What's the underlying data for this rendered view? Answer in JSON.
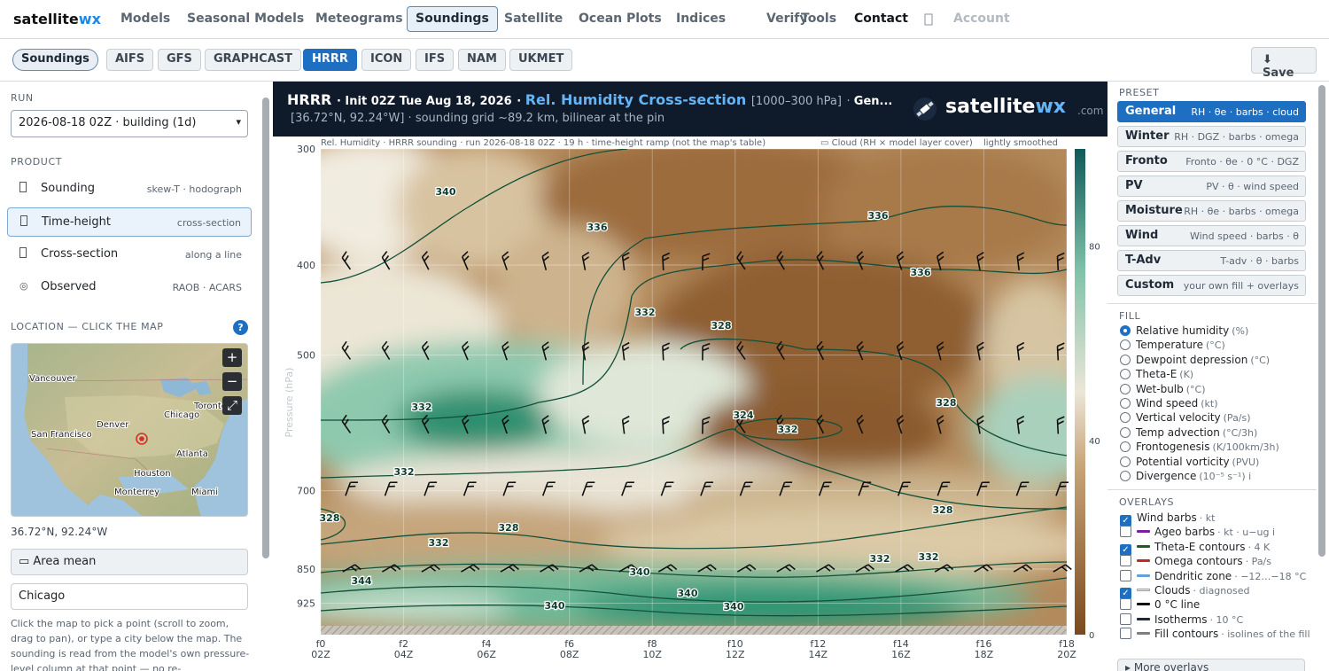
{
  "nav": {
    "brand_a": "satellite",
    "brand_b": "wx",
    "items": [
      "Models",
      "Seasonal Models",
      "Meteograms",
      "Soundings",
      "Satellite",
      "Ocean Plots",
      "Indices",
      "Verify",
      "Tools",
      "Contact"
    ],
    "active_item": "Soundings",
    "icon": "person-icon",
    "account": "Account"
  },
  "subnav": {
    "section": "Soundings",
    "models": [
      "AIFS",
      "GFS",
      "GRAPHCAST",
      "HRRR",
      "ICON",
      "IFS",
      "NAM",
      "UKMET"
    ],
    "selected_model": "HRRR",
    "save": "⬇ Save"
  },
  "left": {
    "run_heading": "RUN",
    "run_value": "2026-08-18 02Z · building (1d)",
    "product_heading": "PRODUCT",
    "products": [
      {
        "name": "Sounding",
        "desc": "skew-T · hodograph",
        "icon": "chart-icon"
      },
      {
        "name": "Time-height",
        "desc": "cross-section",
        "icon": "clock-icon"
      },
      {
        "name": "Cross-section",
        "desc": "along a line",
        "icon": "line-icon"
      },
      {
        "name": "Observed",
        "desc": "RAOB · ACARS",
        "icon": "◎"
      }
    ],
    "selected_product": "Time-height",
    "location_heading": "LOCATION — CLICK THE MAP",
    "help": "?",
    "map_labels": [
      "Vancouver",
      "Chicago",
      "Toronto",
      "Denver",
      "San Francisco",
      "Atlanta",
      "Houston",
      "Monterrey",
      "Miami"
    ],
    "zoom_in": "+",
    "zoom_out": "−",
    "fullscreen": "⤢",
    "coords": "36.72°N, 92.24°W",
    "area_mean": "▭ Area mean",
    "city": "Chicago",
    "help_text": "Click the map to pick a point (scroll to zoom, drag to pan), or type a city below the map. The sounding is read from the model's own pressure-level column at that point — no re-"
  },
  "chart_header": {
    "model": "HRRR",
    "init": "Init 02Z Tue Aug 18, 2026",
    "product": "Rel. Humidity Cross-section",
    "range": "[1000–300 hPa]",
    "preset_short": "Gen...",
    "sub": "[36.72°N, 92.24°W]  ·  sounding grid ~89.2 km, bilinear at the pin",
    "logo_a": "satellite",
    "logo_b": "wx",
    "logo_c": ".com"
  },
  "chart_data": {
    "type": "heatmap",
    "caption": "Rel. Humidity · HRRR sounding · run 2026-08-18 02Z · 19 h · time-height ramp (not the map's table)",
    "cloud_legend": "▭ Cloud (RH × model layer cover)",
    "smoothing": "lightly smoothed",
    "ylabel": "Pressure (hPa)",
    "y_ticks": [
      300,
      400,
      500,
      700,
      850,
      925
    ],
    "ylim": [
      1000,
      300
    ],
    "x_ticks_top": [
      "f0",
      "f2",
      "f4",
      "f6",
      "f8",
      "f10",
      "f12",
      "f14",
      "f16",
      "f18"
    ],
    "x_ticks_bottom": [
      "02Z",
      "04Z",
      "06Z",
      "08Z",
      "10Z",
      "12Z",
      "14Z",
      "16Z",
      "18Z",
      "20Z"
    ],
    "colorbar_ticks": [
      0,
      40,
      80
    ],
    "contour_labels": [
      "340",
      "336",
      "336",
      "332",
      "332",
      "328",
      "336",
      "324",
      "328",
      "332",
      "328",
      "328",
      "328",
      "332",
      "332",
      "340",
      "332",
      "344",
      "340",
      "340",
      "340",
      "332"
    ],
    "barb_levels_hpa": [
      400,
      500,
      600,
      700,
      850
    ],
    "colors": {
      "moist": "#1a8f6e",
      "dry": "#8a5a2b",
      "contour": "#12503a"
    }
  },
  "right": {
    "preset_heading": "PRESET",
    "presets": [
      {
        "name": "General",
        "desc": "RH · θe · barbs · cloud"
      },
      {
        "name": "Winter",
        "desc": "RH · DGZ · barbs · omega"
      },
      {
        "name": "Fronto",
        "desc": "Fronto · θe · 0 °C · DGZ"
      },
      {
        "name": "PV",
        "desc": "PV · θ · wind speed"
      },
      {
        "name": "Moisture",
        "desc": "RH · θe · barbs · omega"
      },
      {
        "name": "Wind",
        "desc": "Wind speed · barbs · θ"
      },
      {
        "name": "T-Adv",
        "desc": "T-adv · θ · barbs"
      },
      {
        "name": "Custom",
        "desc": "your own fill + overlays"
      }
    ],
    "selected_preset": "General",
    "fill_heading": "FILL",
    "fills": [
      {
        "name": "Relative humidity",
        "unit": "(%)"
      },
      {
        "name": "Temperature",
        "unit": "(°C)"
      },
      {
        "name": "Dewpoint depression",
        "unit": "(°C)"
      },
      {
        "name": "Theta-E",
        "unit": "(K)"
      },
      {
        "name": "Wet-bulb",
        "unit": "(°C)"
      },
      {
        "name": "Wind speed",
        "unit": "(kt)"
      },
      {
        "name": "Vertical velocity",
        "unit": "(Pa/s)"
      },
      {
        "name": "Temp advection",
        "unit": "(°C/3h)"
      },
      {
        "name": "Frontogenesis",
        "unit": "(K/100km/3h)"
      },
      {
        "name": "Potential vorticity",
        "unit": "(PVU)"
      },
      {
        "name": "Divergence",
        "unit": "(10⁻⁵ s⁻¹) i"
      }
    ],
    "selected_fill": "Relative humidity",
    "overlays_heading": "OVERLAYS",
    "overlays": [
      {
        "name": "Wind barbs",
        "unit": "· kt",
        "checked": true,
        "color": ""
      },
      {
        "name": "Ageo barbs",
        "unit": "· kt · u−ug  i",
        "checked": false,
        "color": "#7b1fa2"
      },
      {
        "name": "Theta-E contours",
        "unit": "· 4 K",
        "checked": true,
        "color": "#1b5e20"
      },
      {
        "name": "Omega contours",
        "unit": "· Pa/s",
        "checked": false,
        "color": "#c62828"
      },
      {
        "name": "Dendritic zone",
        "unit": "· −12…−18 °C",
        "checked": false,
        "color": "#64a0dc"
      },
      {
        "name": "Clouds",
        "unit": "· diagnosed",
        "checked": true,
        "color": "#f2f2f2"
      },
      {
        "name": "0 °C line",
        "unit": "",
        "checked": false,
        "color": "#111111"
      },
      {
        "name": "Isotherms",
        "unit": "· 10 °C",
        "checked": false,
        "color": "#1f2a36"
      },
      {
        "name": "Fill contours",
        "unit": "· isolines of the fill",
        "checked": false,
        "color": "#7a7f86"
      }
    ],
    "more": "▸ More overlays"
  }
}
